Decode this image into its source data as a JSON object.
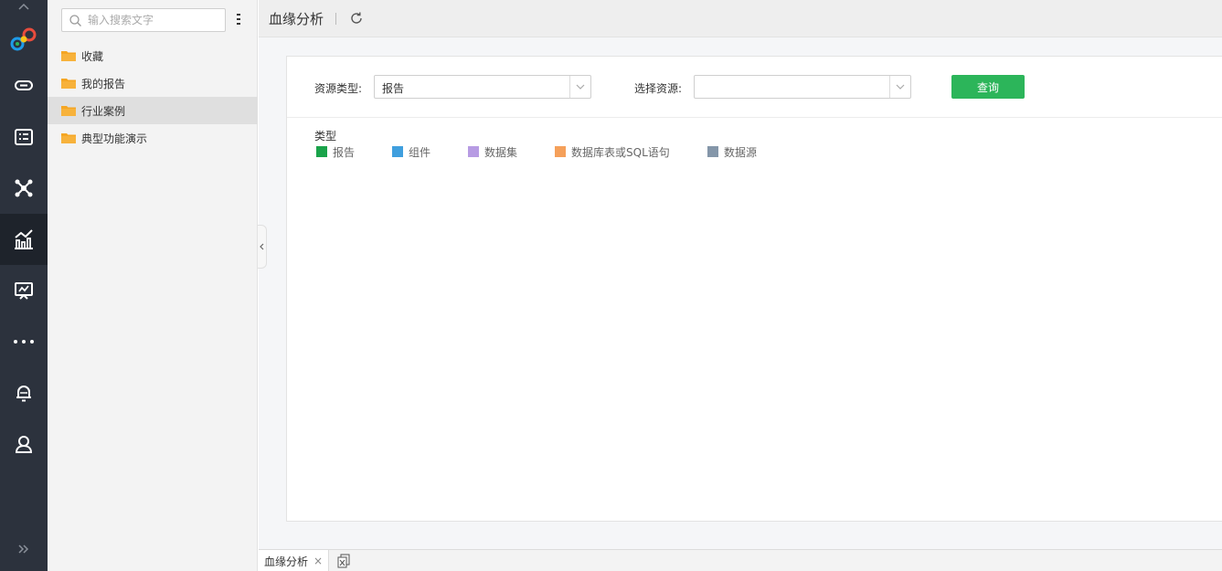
{
  "sidebar": {
    "icons": [
      "collapse-up-icon",
      "logo-icon",
      "link-icon",
      "list-card-icon",
      "network-icon",
      "analysis-chart-icon",
      "presentation-icon",
      "more-icon",
      "bell-icon",
      "user-icon",
      "expand-icon"
    ],
    "active_index": 4
  },
  "tree": {
    "search_placeholder": "输入搜索文字",
    "items": [
      {
        "label": "收藏"
      },
      {
        "label": "我的报告"
      },
      {
        "label": "行业案例"
      },
      {
        "label": "典型功能演示"
      }
    ],
    "selected_index": 2
  },
  "topbar": {
    "title": "血缘分析"
  },
  "query": {
    "resource_type_label": "资源类型:",
    "resource_type_value": "报告",
    "select_resource_label": "选择资源:",
    "select_resource_value": "",
    "query_button": "查询"
  },
  "legend": {
    "title": "类型",
    "items": [
      {
        "label": "报告",
        "color": "#1aa34a"
      },
      {
        "label": "组件",
        "color": "#3f9fde"
      },
      {
        "label": "数据集",
        "color": "#b79be3"
      },
      {
        "label": "数据库表或SQL语句",
        "color": "#f5a05a"
      },
      {
        "label": "数据源",
        "color": "#8496a9"
      }
    ]
  },
  "tabs": [
    {
      "label": "血缘分析",
      "close": "×"
    }
  ],
  "colors": {
    "rail": "#2c323d",
    "accent_green": "#2cb55a",
    "folder": "#f5a623"
  }
}
